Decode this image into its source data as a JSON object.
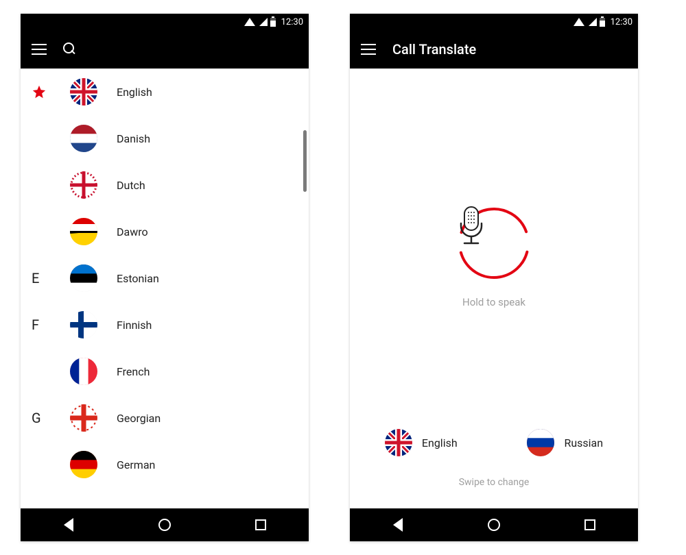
{
  "status": {
    "time": "12:30"
  },
  "left": {
    "appbar": {
      "title": ""
    },
    "sections": [
      {
        "header": "star",
        "items": [
          {
            "label": "English",
            "flag": "uk"
          }
        ]
      },
      {
        "header": "",
        "items": [
          {
            "label": "Danish",
            "flag": "nl"
          },
          {
            "label": "Dutch",
            "flag": "dk"
          },
          {
            "label": "Dawro",
            "flag": "dawro"
          }
        ]
      },
      {
        "header": "E",
        "items": [
          {
            "label": "Estonian",
            "flag": "ee"
          }
        ]
      },
      {
        "header": "F",
        "items": [
          {
            "label": "Finnish",
            "flag": "fi"
          },
          {
            "label": "French",
            "flag": "fr"
          }
        ]
      },
      {
        "header": "G",
        "items": [
          {
            "label": "Georgian",
            "flag": "ge"
          },
          {
            "label": "German",
            "flag": "de"
          }
        ]
      }
    ]
  },
  "right": {
    "appbar": {
      "title": "Call Translate"
    },
    "hold_label": "Hold to speak",
    "swipe_label": "Swipe to change",
    "pair": [
      {
        "label": "English",
        "flag": "uk"
      },
      {
        "label": "Russian",
        "flag": "ru"
      }
    ]
  }
}
